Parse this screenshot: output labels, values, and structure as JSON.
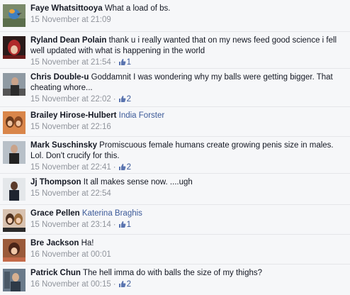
{
  "comments": [
    {
      "author": "Faye Whatsittooya",
      "mention": "",
      "text": "What a load of bs.",
      "timestamp": "15 November at 21:09",
      "likes": ""
    },
    {
      "author": "Ryland Dean Polain",
      "mention": "",
      "text": "thank u i really wanted that on my news feed good science i fell well updated with what is happening in the world",
      "timestamp": "15 November at 21:54",
      "likes": "1"
    },
    {
      "author": "Chris Double-u",
      "mention": "",
      "text": "Goddamnit I was wondering why my balls were getting bigger. That cheating whore...",
      "timestamp": "15 November at 22:02",
      "likes": "2"
    },
    {
      "author": "Brailey Hirose-Hulbert",
      "mention": "India Forster",
      "text": "",
      "timestamp": "15 November at 22:16",
      "likes": ""
    },
    {
      "author": "Mark Suschinsky",
      "mention": "",
      "text": "Promiscuous female humans create growing penis size in males. Lol. Don't crucify for this.",
      "timestamp": "15 November at 22:41",
      "likes": "2"
    },
    {
      "author": "Jj Thompson",
      "mention": "",
      "text": "It all makes sense now. ....ugh",
      "timestamp": "15 November at 22:54",
      "likes": ""
    },
    {
      "author": "Grace Pellen",
      "mention": "Katerina Braghis",
      "text": "",
      "timestamp": "15 November at 23:14",
      "likes": "1"
    },
    {
      "author": "Bre Jackson",
      "mention": "",
      "text": "Ha!",
      "timestamp": "16 November at 00:01",
      "likes": ""
    },
    {
      "author": "Patrick Chun",
      "mention": "",
      "text": "The hell imma do with balls the size of my thighs?",
      "timestamp": "16 November at 00:15",
      "likes": "2"
    }
  ],
  "icons": {
    "like": "thumbs-up-icon"
  },
  "colors": {
    "background": "#f6f7f9",
    "link": "#3b5998",
    "meta": "#90949c",
    "text": "#141823"
  }
}
